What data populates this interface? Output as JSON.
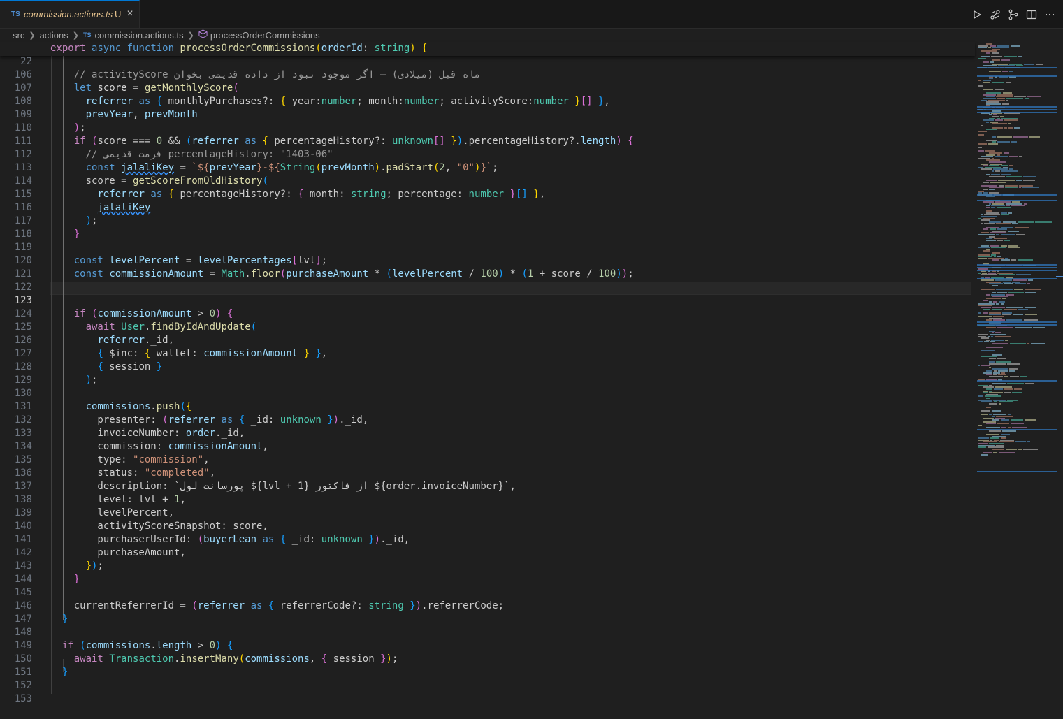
{
  "tab": {
    "badge": "TS",
    "title": "commission.actions.ts",
    "status": "U",
    "close": "×"
  },
  "breadcrumb": {
    "seg1": "src",
    "seg2": "actions",
    "badge": "TS",
    "file": "commission.actions.ts",
    "symbol": "processOrderCommissions"
  },
  "editor": {
    "active_line": "123"
  },
  "lines": [
    {
      "num": "22",
      "text": "export async function processOrderCommissions(orderId: string) {"
    },
    {
      "num": "106",
      "text": ""
    },
    {
      "num": "107",
      "text": "    // activityScore ماه قبل (میلادی) — اگر موجود نبود از داده قدیمی بخوان"
    },
    {
      "num": "108",
      "text": "    let score = getMonthlyScore("
    },
    {
      "num": "109",
      "text": "      referrer as { monthlyPurchases?: { year:number; month:number; activityScore:number }[] },"
    },
    {
      "num": "110",
      "text": "      prevYear, prevMonth"
    },
    {
      "num": "111",
      "text": "    );"
    },
    {
      "num": "112",
      "text": "    if (score === 0 && (referrer as { percentageHistory?: unknown[] }).percentageHistory?.length) {"
    },
    {
      "num": "113",
      "text": "      // فرمت قدیمی percentageHistory: \"1403-06\""
    },
    {
      "num": "114",
      "text": "      const jalaliKey = `${prevYear}-${String(prevMonth).padStart(2, \"0\")}`;"
    },
    {
      "num": "115",
      "text": "      score = getScoreFromOldHistory("
    },
    {
      "num": "116",
      "text": "        referrer as { percentageHistory?: { month: string; percentage: number }[] },"
    },
    {
      "num": "117",
      "text": "        jalaliKey"
    },
    {
      "num": "118",
      "text": "      );"
    },
    {
      "num": "119",
      "text": "    }"
    },
    {
      "num": "120",
      "text": ""
    },
    {
      "num": "121",
      "text": "    const levelPercent = levelPercentages[lvl];"
    },
    {
      "num": "122",
      "text": "    const commissionAmount = Math.floor(purchaseAmount * (levelPercent / 100) * (1 + score / 100));"
    },
    {
      "num": "123",
      "text": ""
    },
    {
      "num": "124",
      "text": ""
    },
    {
      "num": "125",
      "text": "    if (commissionAmount > 0) {"
    },
    {
      "num": "126",
      "text": "      await User.findByIdAndUpdate("
    },
    {
      "num": "127",
      "text": "        referrer._id,"
    },
    {
      "num": "128",
      "text": "        { $inc: { wallet: commissionAmount } },"
    },
    {
      "num": "129",
      "text": "        { session }"
    },
    {
      "num": "130",
      "text": "      );"
    },
    {
      "num": "131",
      "text": ""
    },
    {
      "num": "132",
      "text": "      commissions.push({"
    },
    {
      "num": "133",
      "text": "        presenter: (referrer as { _id: unknown })._id,"
    },
    {
      "num": "134",
      "text": "        invoiceNumber: order._id,"
    },
    {
      "num": "135",
      "text": "        commission: commissionAmount,"
    },
    {
      "num": "136",
      "text": "        type: \"commission\","
    },
    {
      "num": "137",
      "text": "        status: \"completed\","
    },
    {
      "num": "138",
      "text": "        description: `پورسانت لول ${lvl + 1} از فاکتور ${order.invoiceNumber}`,"
    },
    {
      "num": "139",
      "text": "        level: lvl + 1,"
    },
    {
      "num": "140",
      "text": "        levelPercent,"
    },
    {
      "num": "141",
      "text": "        activityScoreSnapshot: score,"
    },
    {
      "num": "142",
      "text": "        purchaserUserId: (buyerLean as { _id: unknown })._id,"
    },
    {
      "num": "143",
      "text": "        purchaseAmount,"
    },
    {
      "num": "144",
      "text": "      });"
    },
    {
      "num": "145",
      "text": "    }"
    },
    {
      "num": "146",
      "text": ""
    },
    {
      "num": "147",
      "text": "    currentReferrerId = (referrer as { referrerCode?: string }).referrerCode;"
    },
    {
      "num": "148",
      "text": "  }"
    },
    {
      "num": "149",
      "text": ""
    },
    {
      "num": "150",
      "text": "  if (commissions.length > 0) {"
    },
    {
      "num": "151",
      "text": "    await Transaction.insertMany(commissions, { session });"
    },
    {
      "num": "152",
      "text": "  }"
    },
    {
      "num": "153",
      "text": ""
    }
  ],
  "icons": [
    "run-icon",
    "git-compare-icon",
    "source-control-icon",
    "split-editor-icon",
    "more-actions-icon",
    "close-icon",
    "chevron-right-icon",
    "symbol-method-icon"
  ]
}
